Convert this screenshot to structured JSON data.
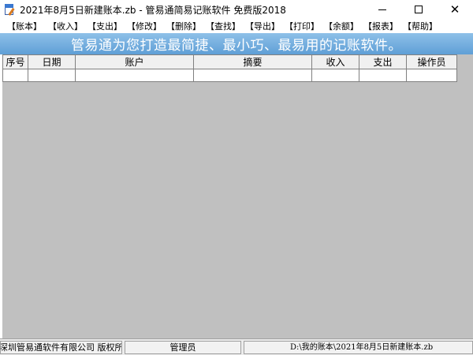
{
  "window": {
    "title": "2021年8月5日新建账本.zb - 管易通简易记账软件 免费版2018",
    "app_icon": "ledger-app-icon",
    "controls": {
      "minimize_icon": "minimize-icon",
      "maximize_icon": "maximize-icon",
      "close_icon": "close-icon",
      "close_glyph": "✕"
    }
  },
  "menu": [
    {
      "label": "【账本】"
    },
    {
      "label": "【收入】"
    },
    {
      "label": "【支出】"
    },
    {
      "label": "【修改】"
    },
    {
      "label": "【删除】"
    },
    {
      "label": "【查找】"
    },
    {
      "label": "【导出】"
    },
    {
      "label": "【打印】"
    },
    {
      "label": "【余额】"
    },
    {
      "label": "【报表】"
    },
    {
      "label": "【帮助】"
    }
  ],
  "banner": {
    "text": "管易通为您打造最简捷、最小巧、最易用的记账软件。"
  },
  "table": {
    "columns": [
      "序号",
      "日期",
      "账户",
      "摘要",
      "收入",
      "支出",
      "操作员"
    ],
    "rows": [
      [
        "",
        "",
        "",
        "",
        "",
        "",
        ""
      ]
    ]
  },
  "status": {
    "copyright": "深圳管易通软件有限公司 版权所有(C",
    "user": "管理员",
    "path": "D:\\我的账本\\2021年8月5日新建账本.zb"
  },
  "colors": {
    "banner_top": "#8ec0e8",
    "banner_bottom": "#5f9fd6",
    "workspace": "#c0c0c0",
    "banner_text": "#ffffff"
  }
}
